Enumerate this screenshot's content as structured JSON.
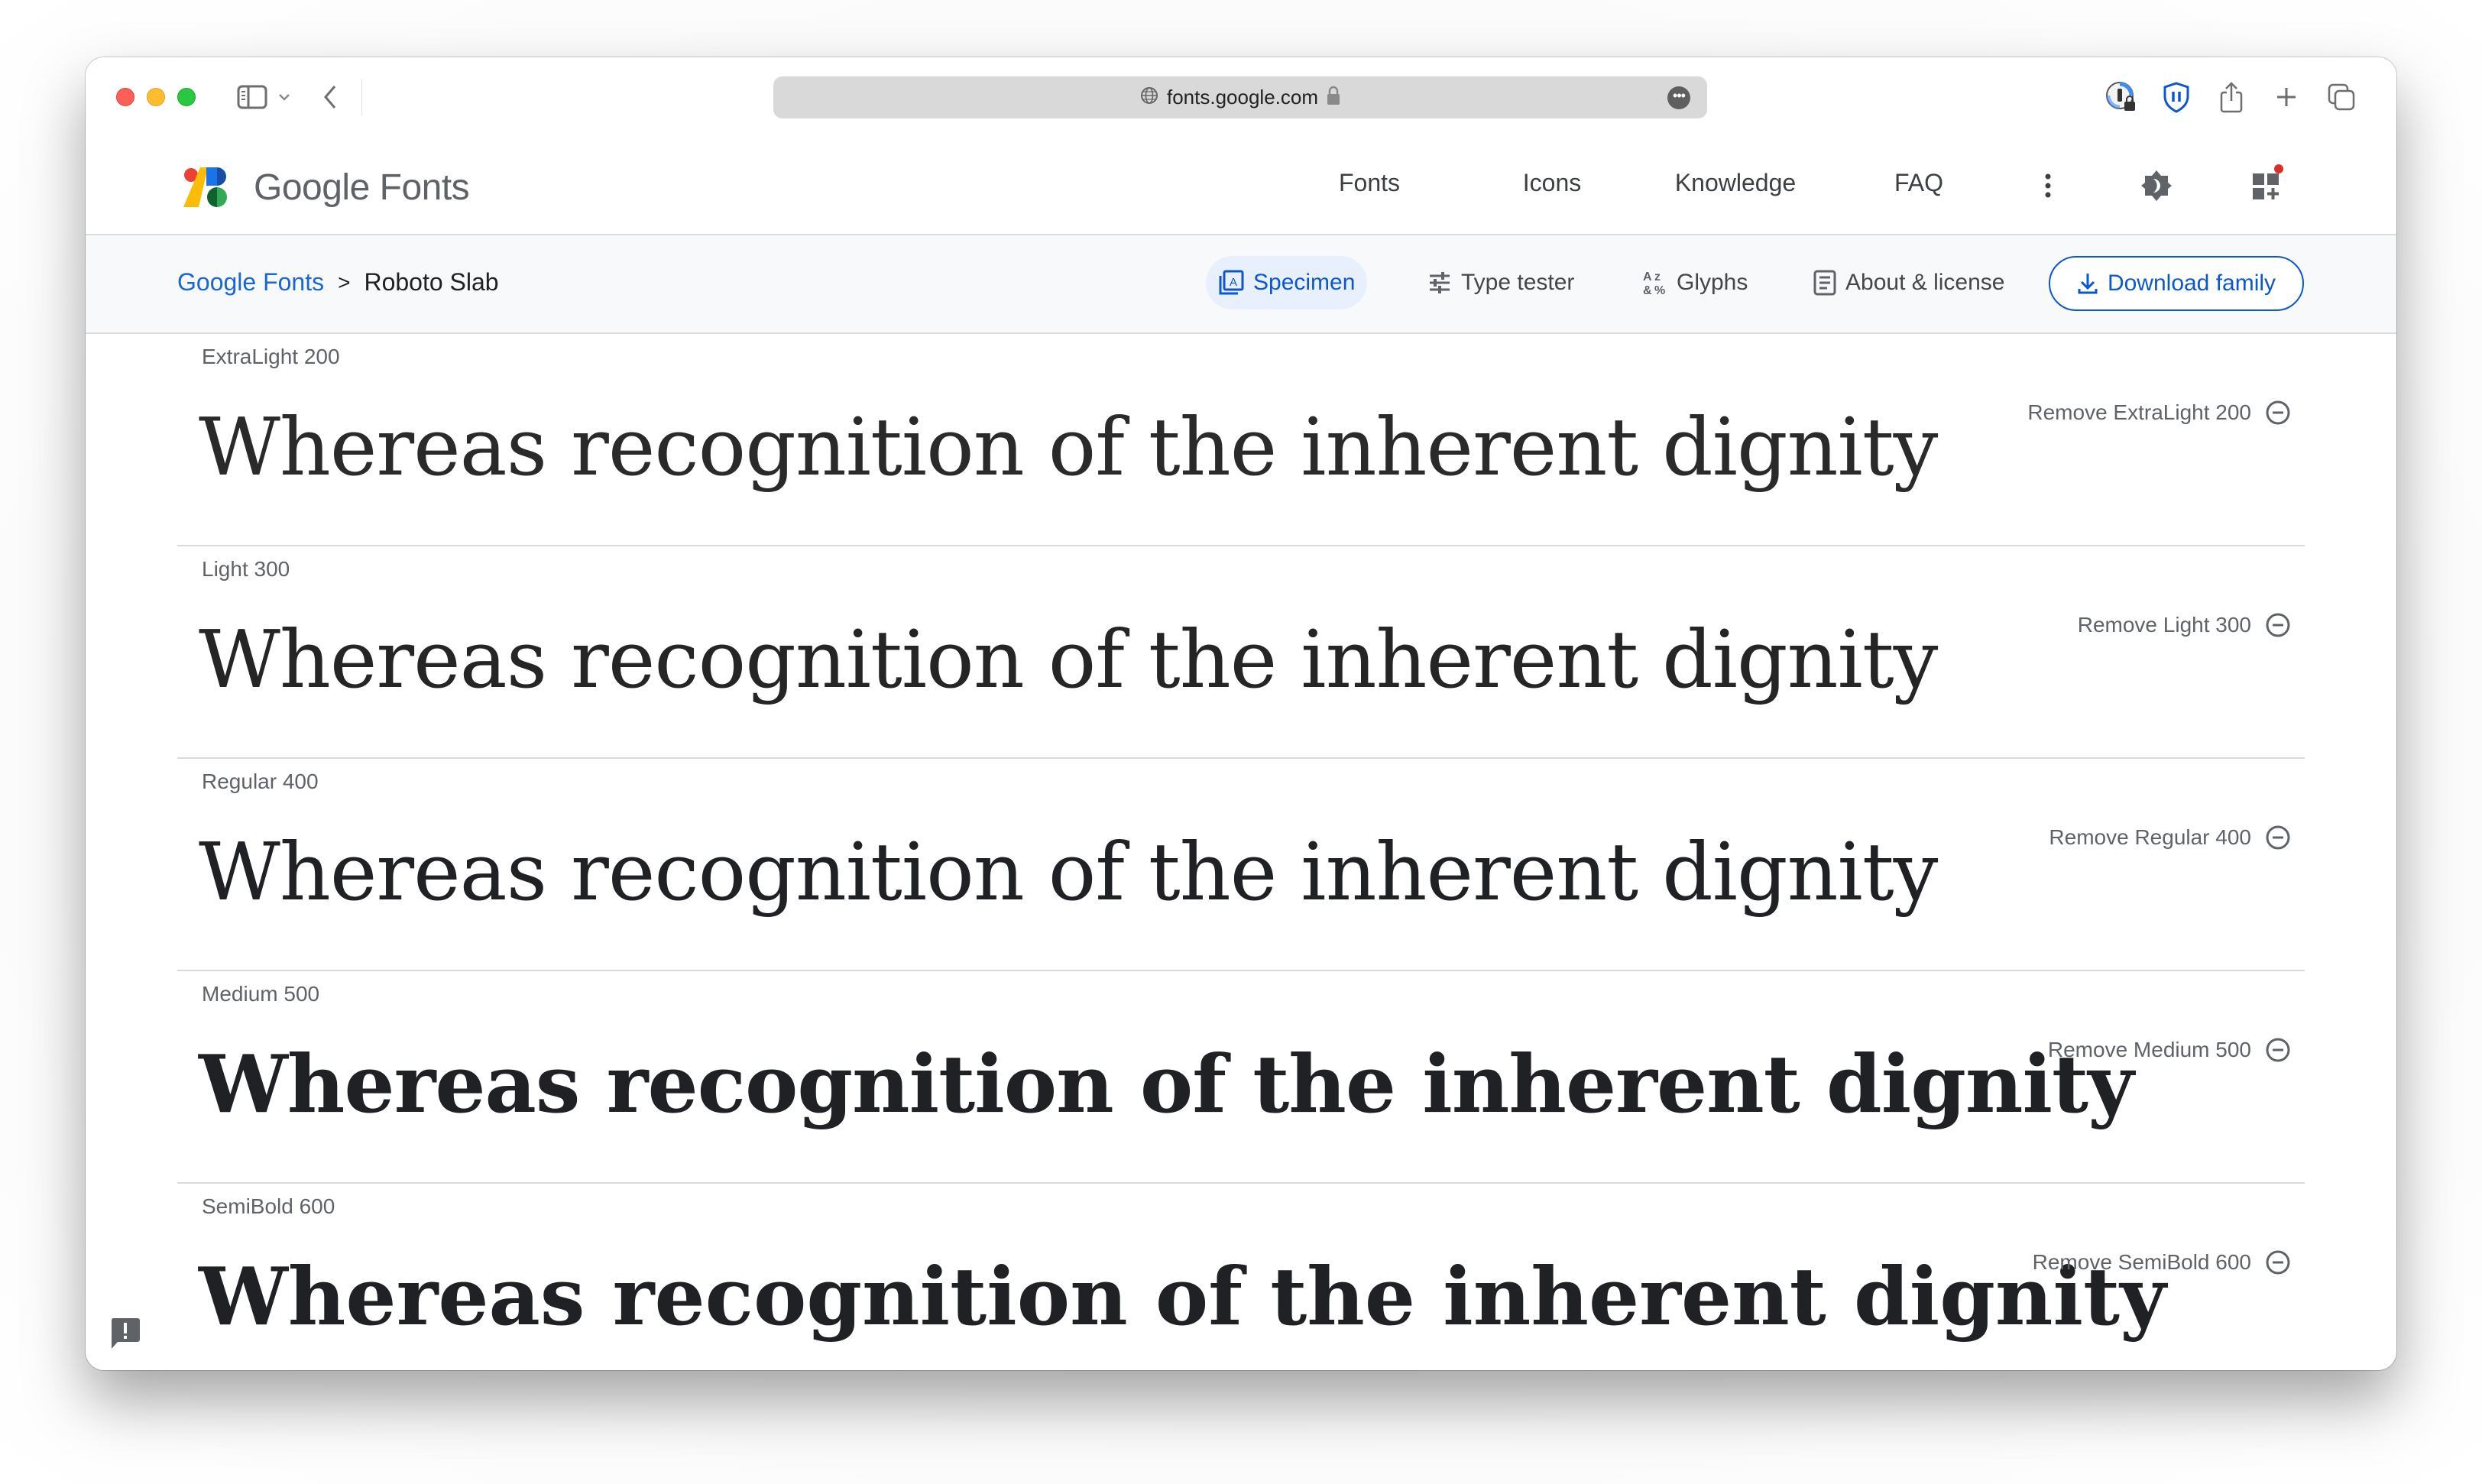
{
  "browser": {
    "url": "fonts.google.com",
    "icons": [
      "sidebar-icon",
      "chevron-down-icon",
      "back-icon",
      "globe-icon",
      "lock-icon",
      "more-icon",
      "password-manager-icon",
      "privacy-shield-icon",
      "share-icon",
      "new-tab-icon",
      "tabs-overview-icon"
    ]
  },
  "header": {
    "logo_text": "Google Fonts",
    "nav": [
      {
        "label": "Fonts"
      },
      {
        "label": "Icons"
      },
      {
        "label": "Knowledge"
      },
      {
        "label": "FAQ"
      }
    ],
    "icons": [
      "more-vert-icon",
      "theme-toggle-icon",
      "apps-add-icon"
    ],
    "notification_color": "#d93025"
  },
  "subheader": {
    "breadcrumb": [
      {
        "label": "Google Fonts"
      },
      {
        "label": "Roboto Slab"
      }
    ],
    "breadcrumb_separator": ">",
    "tabs": [
      {
        "label": "Specimen",
        "active": true
      },
      {
        "label": "Type tester",
        "active": false
      },
      {
        "label": "Glyphs",
        "active": false
      },
      {
        "label": "About & license",
        "active": false
      }
    ],
    "download_label": "Download family",
    "accent_color": "#0b57d0"
  },
  "styles": [
    {
      "label": "ExtraLight 200",
      "weight": 200,
      "sample": "Whereas recognition of the inherent dignity",
      "remove_label": "Remove ExtraLight 200"
    },
    {
      "label": "Light 300",
      "weight": 300,
      "sample": "Whereas recognition of the inherent dignity",
      "remove_label": "Remove Light 300"
    },
    {
      "label": "Regular 400",
      "weight": 400,
      "sample": "Whereas recognition of the inherent dignity",
      "remove_label": "Remove Regular 400"
    },
    {
      "label": "Medium 500",
      "weight": 500,
      "sample": "Whereas recognition of the inherent dignity",
      "remove_label": "Remove Medium 500"
    },
    {
      "label": "SemiBold 600",
      "weight": 600,
      "sample": "Whereas recognition of the inherent dignity",
      "remove_label": "Remove SemiBold 600"
    }
  ]
}
